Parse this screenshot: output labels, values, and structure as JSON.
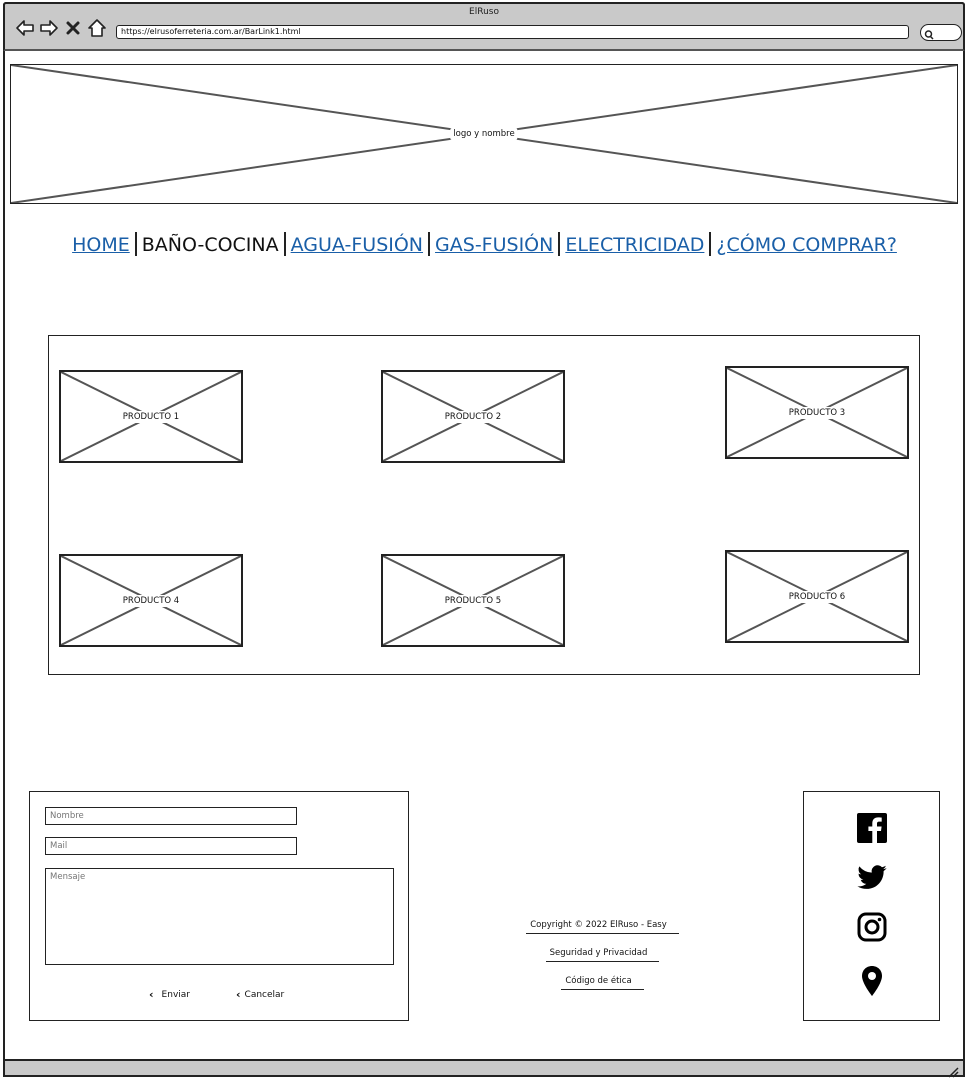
{
  "window": {
    "title": "ElRuso"
  },
  "browser": {
    "url": "https://elrusoferreteria.com.ar/BarLink1.html"
  },
  "header": {
    "logo_label": "logo y nombre"
  },
  "menu": {
    "items": [
      {
        "label": "HOME",
        "current": false
      },
      {
        "label": "BAÑO-COCINA",
        "current": true
      },
      {
        "label": "AGUA-FUSIÓN",
        "current": false
      },
      {
        "label": "GAS-FUSIÓN",
        "current": false
      },
      {
        "label": "ELECTRICIDAD",
        "current": false
      },
      {
        "label": "¿CÓMO COMPRAR?",
        "current": false
      }
    ],
    "link_color": "#1a5fa8"
  },
  "products": [
    "PRODUCTO 1",
    "PRODUCTO 2",
    "PRODUCTO 3",
    "PRODUCTO 4",
    "PRODUCTO 5",
    "PRODUCTO 6"
  ],
  "form": {
    "name_placeholder": "Nombre",
    "mail_placeholder": "Mail",
    "message_placeholder": "Mensaje",
    "send_label": "Enviar",
    "cancel_label": "Cancelar"
  },
  "footer": {
    "copyright": "Copyright © 2022 ElRuso - Easy",
    "privacy": "Seguridad y Privacidad",
    "ethics": "Código de ética"
  },
  "social": {
    "icons": [
      "facebook-icon",
      "twitter-icon",
      "instagram-icon",
      "location-pin-icon"
    ]
  }
}
